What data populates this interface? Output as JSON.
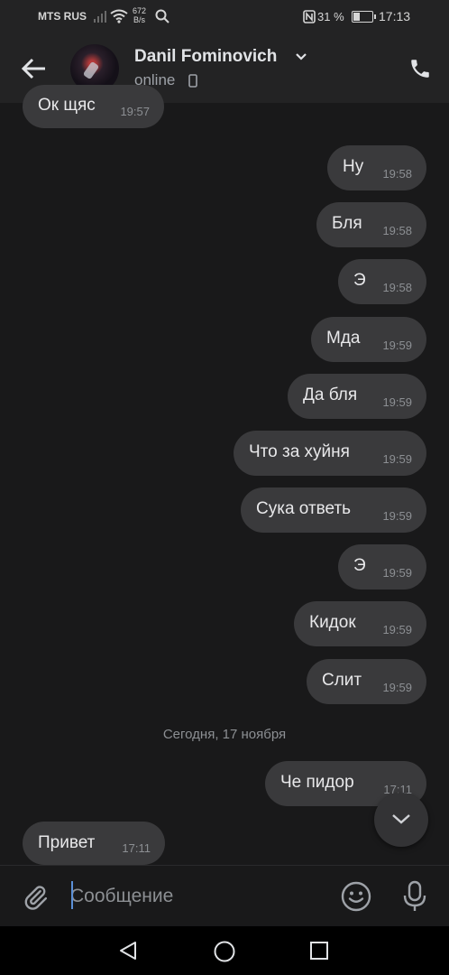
{
  "status_bar": {
    "carrier": "MTS RUS",
    "net_speed_value": "672",
    "net_speed_unit": "B/s",
    "battery_percent": "31 %",
    "time": "17:13"
  },
  "header": {
    "contact_name": "Danil Fominovich",
    "status": "online"
  },
  "messages": [
    {
      "text": "Ок щяс",
      "time": "19:57",
      "side": "in"
    },
    {
      "text": "Ну",
      "time": "19:58",
      "side": "out"
    },
    {
      "text": "Бля",
      "time": "19:58",
      "side": "out"
    },
    {
      "text": "Э",
      "time": "19:58",
      "side": "out"
    },
    {
      "text": "Мда",
      "time": "19:59",
      "side": "out"
    },
    {
      "text": "Да бля",
      "time": "19:59",
      "side": "out"
    },
    {
      "text": "Что за хуйня",
      "time": "19:59",
      "side": "out"
    },
    {
      "text": "Сука ответь",
      "time": "19:59",
      "side": "out"
    },
    {
      "text": "Э",
      "time": "19:59",
      "side": "out"
    },
    {
      "text": "Кидок",
      "time": "19:59",
      "side": "out"
    },
    {
      "text": "Слит",
      "time": "19:59",
      "side": "out"
    },
    {
      "text": "Че пидор",
      "time": "17:11",
      "side": "out"
    },
    {
      "text": "Привет",
      "time": "17:11",
      "side": "in"
    }
  ],
  "date_separator": "Сегодня, 17 ноября",
  "composer": {
    "placeholder": "Сообщение"
  },
  "colors": {
    "background": "#19191a",
    "header": "#232324",
    "bubble": "#3a3a3c",
    "caret": "#5b8fd6"
  }
}
